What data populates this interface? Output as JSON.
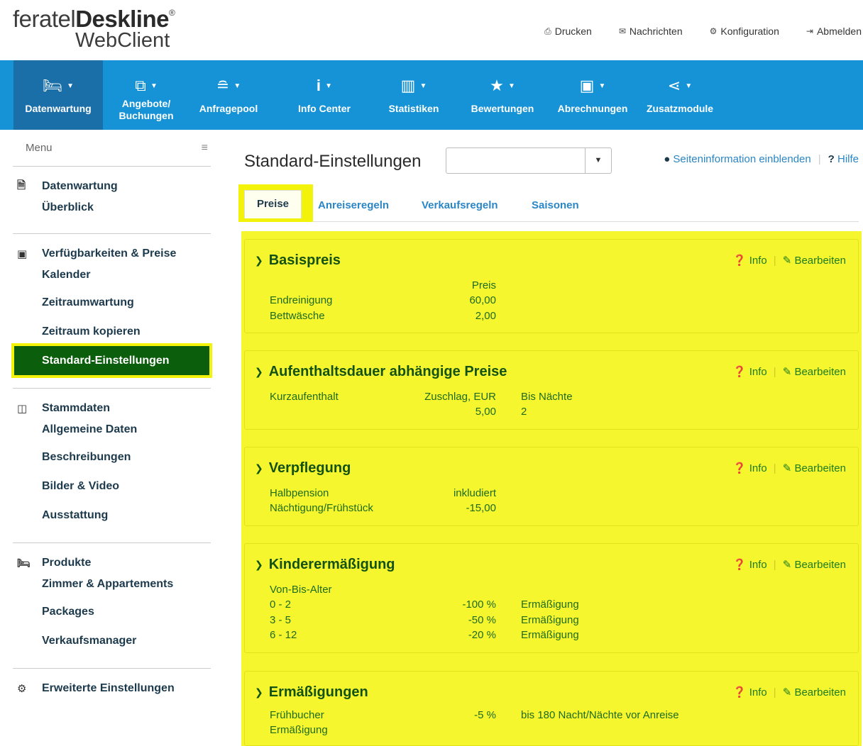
{
  "header": {
    "logo_brand_light": "feratel",
    "logo_brand_bold": "Deskline",
    "logo_reg": "®",
    "logo_sub": "WebClient",
    "links": [
      {
        "label": "Drucken",
        "icon": "print-icon"
      },
      {
        "label": "Nachrichten",
        "icon": "envelope-icon"
      },
      {
        "label": "Konfiguration",
        "icon": "gear-icon"
      },
      {
        "label": "Abmelden",
        "icon": "sign-out-icon"
      }
    ]
  },
  "nav": {
    "items": [
      {
        "label": "Datenwartung",
        "icon": "bed-icon",
        "active": true
      },
      {
        "label1": "Angebote/",
        "label2": "Buchungen",
        "icon": "documents-icon"
      },
      {
        "label": "Anfragepool",
        "icon": "stack-icon"
      },
      {
        "label": "Info Center",
        "icon": "info-icon"
      },
      {
        "label": "Statistiken",
        "icon": "bar-chart-icon"
      },
      {
        "label": "Bewertungen",
        "icon": "star-icon"
      },
      {
        "label": "Abrechnungen",
        "icon": "money-icon"
      },
      {
        "label": "Zusatzmodule",
        "icon": "share-icon"
      }
    ]
  },
  "sidebar": {
    "menu_label": "Menu",
    "sections": [
      {
        "title": "Datenwartung",
        "items": [
          "Überblick"
        ]
      },
      {
        "title": "Verfügbarkeiten & Preise",
        "items": [
          "Kalender",
          "Zeitraumwartung",
          "Zeitraum kopieren",
          "Standard-Einstellungen"
        ],
        "active_item": "Standard-Einstellungen"
      },
      {
        "title": "Stammdaten",
        "items": [
          "Allgemeine Daten",
          "Beschreibungen",
          "Bilder & Video",
          "Ausstattung"
        ]
      },
      {
        "title": "Produkte",
        "items": [
          "Zimmer & Appartements",
          "Packages",
          "Verkaufsmanager"
        ]
      },
      {
        "title": "Erweiterte Einstellungen",
        "items": []
      }
    ]
  },
  "main": {
    "title": "Standard-Einstellungen",
    "select_value": "",
    "page_info_label": "Seiteninformation einblenden",
    "help_label": "Hilfe",
    "tabs": [
      "Preise",
      "Anreiseregeln",
      "Verkaufsregeln",
      "Saisonen"
    ],
    "active_tab": "Preise",
    "info_label": "Info",
    "edit_label": "Bearbeiten",
    "panels": {
      "basispreis": {
        "title": "Basispreis",
        "header": "Preis",
        "rows": [
          {
            "name": "Endreinigung",
            "value": "60,00"
          },
          {
            "name": "Bettwäsche",
            "value": "2,00"
          }
        ]
      },
      "aufenthalt": {
        "title": "Aufenthaltsdauer abhängige Preise",
        "name": "Kurzaufenthalt",
        "col1_header": "Zuschlag, EUR",
        "col2_header": "Bis Nächte",
        "col1_value": "5,00",
        "col2_value": "2"
      },
      "verpflegung": {
        "title": "Verpflegung",
        "rows": [
          {
            "name": "Halbpension",
            "value": "inkludiert"
          },
          {
            "name": "Nächtigung/Frühstück",
            "value": "-15,00"
          }
        ]
      },
      "kinder": {
        "title": "Kinderermäßigung",
        "header": "Von-Bis-Alter",
        "rows": [
          {
            "age": "0 - 2",
            "value": "-100 %",
            "label": "Ermäßigung"
          },
          {
            "age": "3 - 5",
            "value": "-50 %",
            "label": "Ermäßigung"
          },
          {
            "age": "6 - 12",
            "value": "-20 %",
            "label": "Ermäßigung"
          }
        ]
      },
      "ermaessigungen": {
        "title": "Ermäßigungen",
        "name1": "Frühbucher",
        "name2": "Ermäßigung",
        "value": "-5 %",
        "description": "bis 180 Nacht/Nächte vor Anreise"
      }
    }
  },
  "colors": {
    "nav_bg": "#1693d6",
    "nav_active": "#1a6fa8",
    "highlight": "#f2f20a",
    "active_menu": "#0b5e0b",
    "panel_text": "#145214",
    "link": "#2a86c5"
  }
}
